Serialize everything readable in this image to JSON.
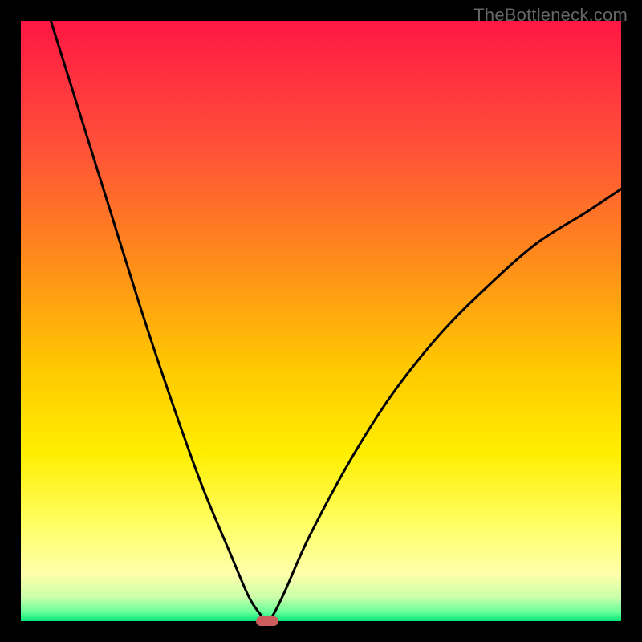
{
  "watermark": "TheBottleneck.com",
  "chart_data": {
    "type": "line",
    "title": "",
    "xlabel": "",
    "ylabel": "",
    "xlim": [
      0,
      100
    ],
    "ylim": [
      0,
      100
    ],
    "series": [
      {
        "name": "bottleneck-curve",
        "x": [
          5,
          10,
          15,
          20,
          25,
          30,
          35,
          38,
          40,
          41,
          42,
          44,
          48,
          55,
          62,
          70,
          78,
          86,
          94,
          100
        ],
        "values": [
          100,
          84,
          68,
          52,
          37,
          23,
          11,
          4,
          1,
          0,
          1,
          5,
          14,
          27,
          38,
          48,
          56,
          63,
          68,
          72
        ]
      }
    ],
    "annotations": [
      {
        "type": "marker",
        "x": 41,
        "y": 0,
        "label": "optimal-point"
      }
    ],
    "gradient_stops": [
      {
        "offset": 0,
        "color": "#ff1744"
      },
      {
        "offset": 20,
        "color": "#ff4e3a"
      },
      {
        "offset": 40,
        "color": "#ff8c1a"
      },
      {
        "offset": 58,
        "color": "#ffc900"
      },
      {
        "offset": 72,
        "color": "#ffee00"
      },
      {
        "offset": 84,
        "color": "#ffff66"
      },
      {
        "offset": 92,
        "color": "#ffffaa"
      },
      {
        "offset": 96,
        "color": "#ccffaa"
      },
      {
        "offset": 98.5,
        "color": "#66ff99"
      },
      {
        "offset": 100,
        "color": "#00e676"
      }
    ]
  }
}
